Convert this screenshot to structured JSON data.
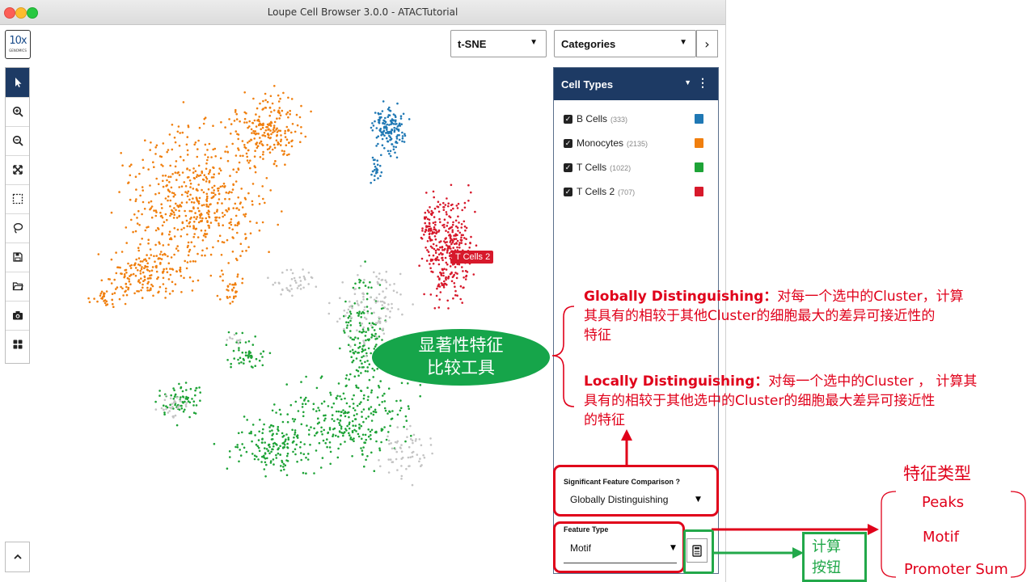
{
  "window": {
    "title": "Loupe Cell Browser 3.0.0 - ATACTutorial"
  },
  "logo": {
    "big": "10x",
    "small": "GENOMICS"
  },
  "toolbar": [
    {
      "name": "pointer-tool",
      "icon": "cursor-icon"
    },
    {
      "name": "zoom-in-tool",
      "icon": "zoom-in-icon"
    },
    {
      "name": "zoom-out-tool",
      "icon": "zoom-out-icon"
    },
    {
      "name": "fit-tool",
      "icon": "expand-icon"
    },
    {
      "name": "box-select-tool",
      "icon": "box-select-icon"
    },
    {
      "name": "lasso-tool",
      "icon": "lasso-icon"
    },
    {
      "name": "save-tool",
      "icon": "save-icon"
    },
    {
      "name": "open-tool",
      "icon": "folder-icon"
    },
    {
      "name": "screenshot-tool",
      "icon": "camera-icon"
    },
    {
      "name": "layout-tool",
      "icon": "grid-icon"
    }
  ],
  "header": {
    "projection": "t-SNE",
    "category": "Categories"
  },
  "panel": {
    "title": "Cell Types",
    "cell_types": [
      {
        "name": "B Cells",
        "count": "(333)",
        "color": "#1f78b4"
      },
      {
        "name": "Monocytes",
        "count": "(2135)",
        "color": "#f07f0e"
      },
      {
        "name": "T Cells",
        "count": "(1022)",
        "color": "#1ea337"
      },
      {
        "name": "T Cells 2",
        "count": "(707)",
        "color": "#d7192b"
      }
    ],
    "sfc_label": "Significant Feature Comparison",
    "sfc_value": "Globally Distinguishing",
    "feature_type_label": "Feature Type",
    "feature_type_value": "Motif"
  },
  "cluster_label": "T Cells 2",
  "annotation": {
    "callout_line1": "显著性特征",
    "callout_line2": "比较工具",
    "global_title": "Globally Distinguishing：",
    "global_l1": "对每一个选中的Cluster，计算",
    "global_l2": "其具有的相较于其他Cluster的细胞最大的差异可接近性的",
    "global_l3": "特征",
    "local_title": "Locally Distinguishing：",
    "local_l1": "对每一个选中的Cluster ， 计算其",
    "local_l2": "具有的相较于其他选中的Cluster的细胞最大差异可接近性",
    "local_l3": "的特征",
    "feature_types_title": "特征类型",
    "feature_types": [
      "Peaks",
      "Motif",
      "Promoter Sum"
    ],
    "calc_l1": "计算",
    "calc_l2": "按钮"
  }
}
